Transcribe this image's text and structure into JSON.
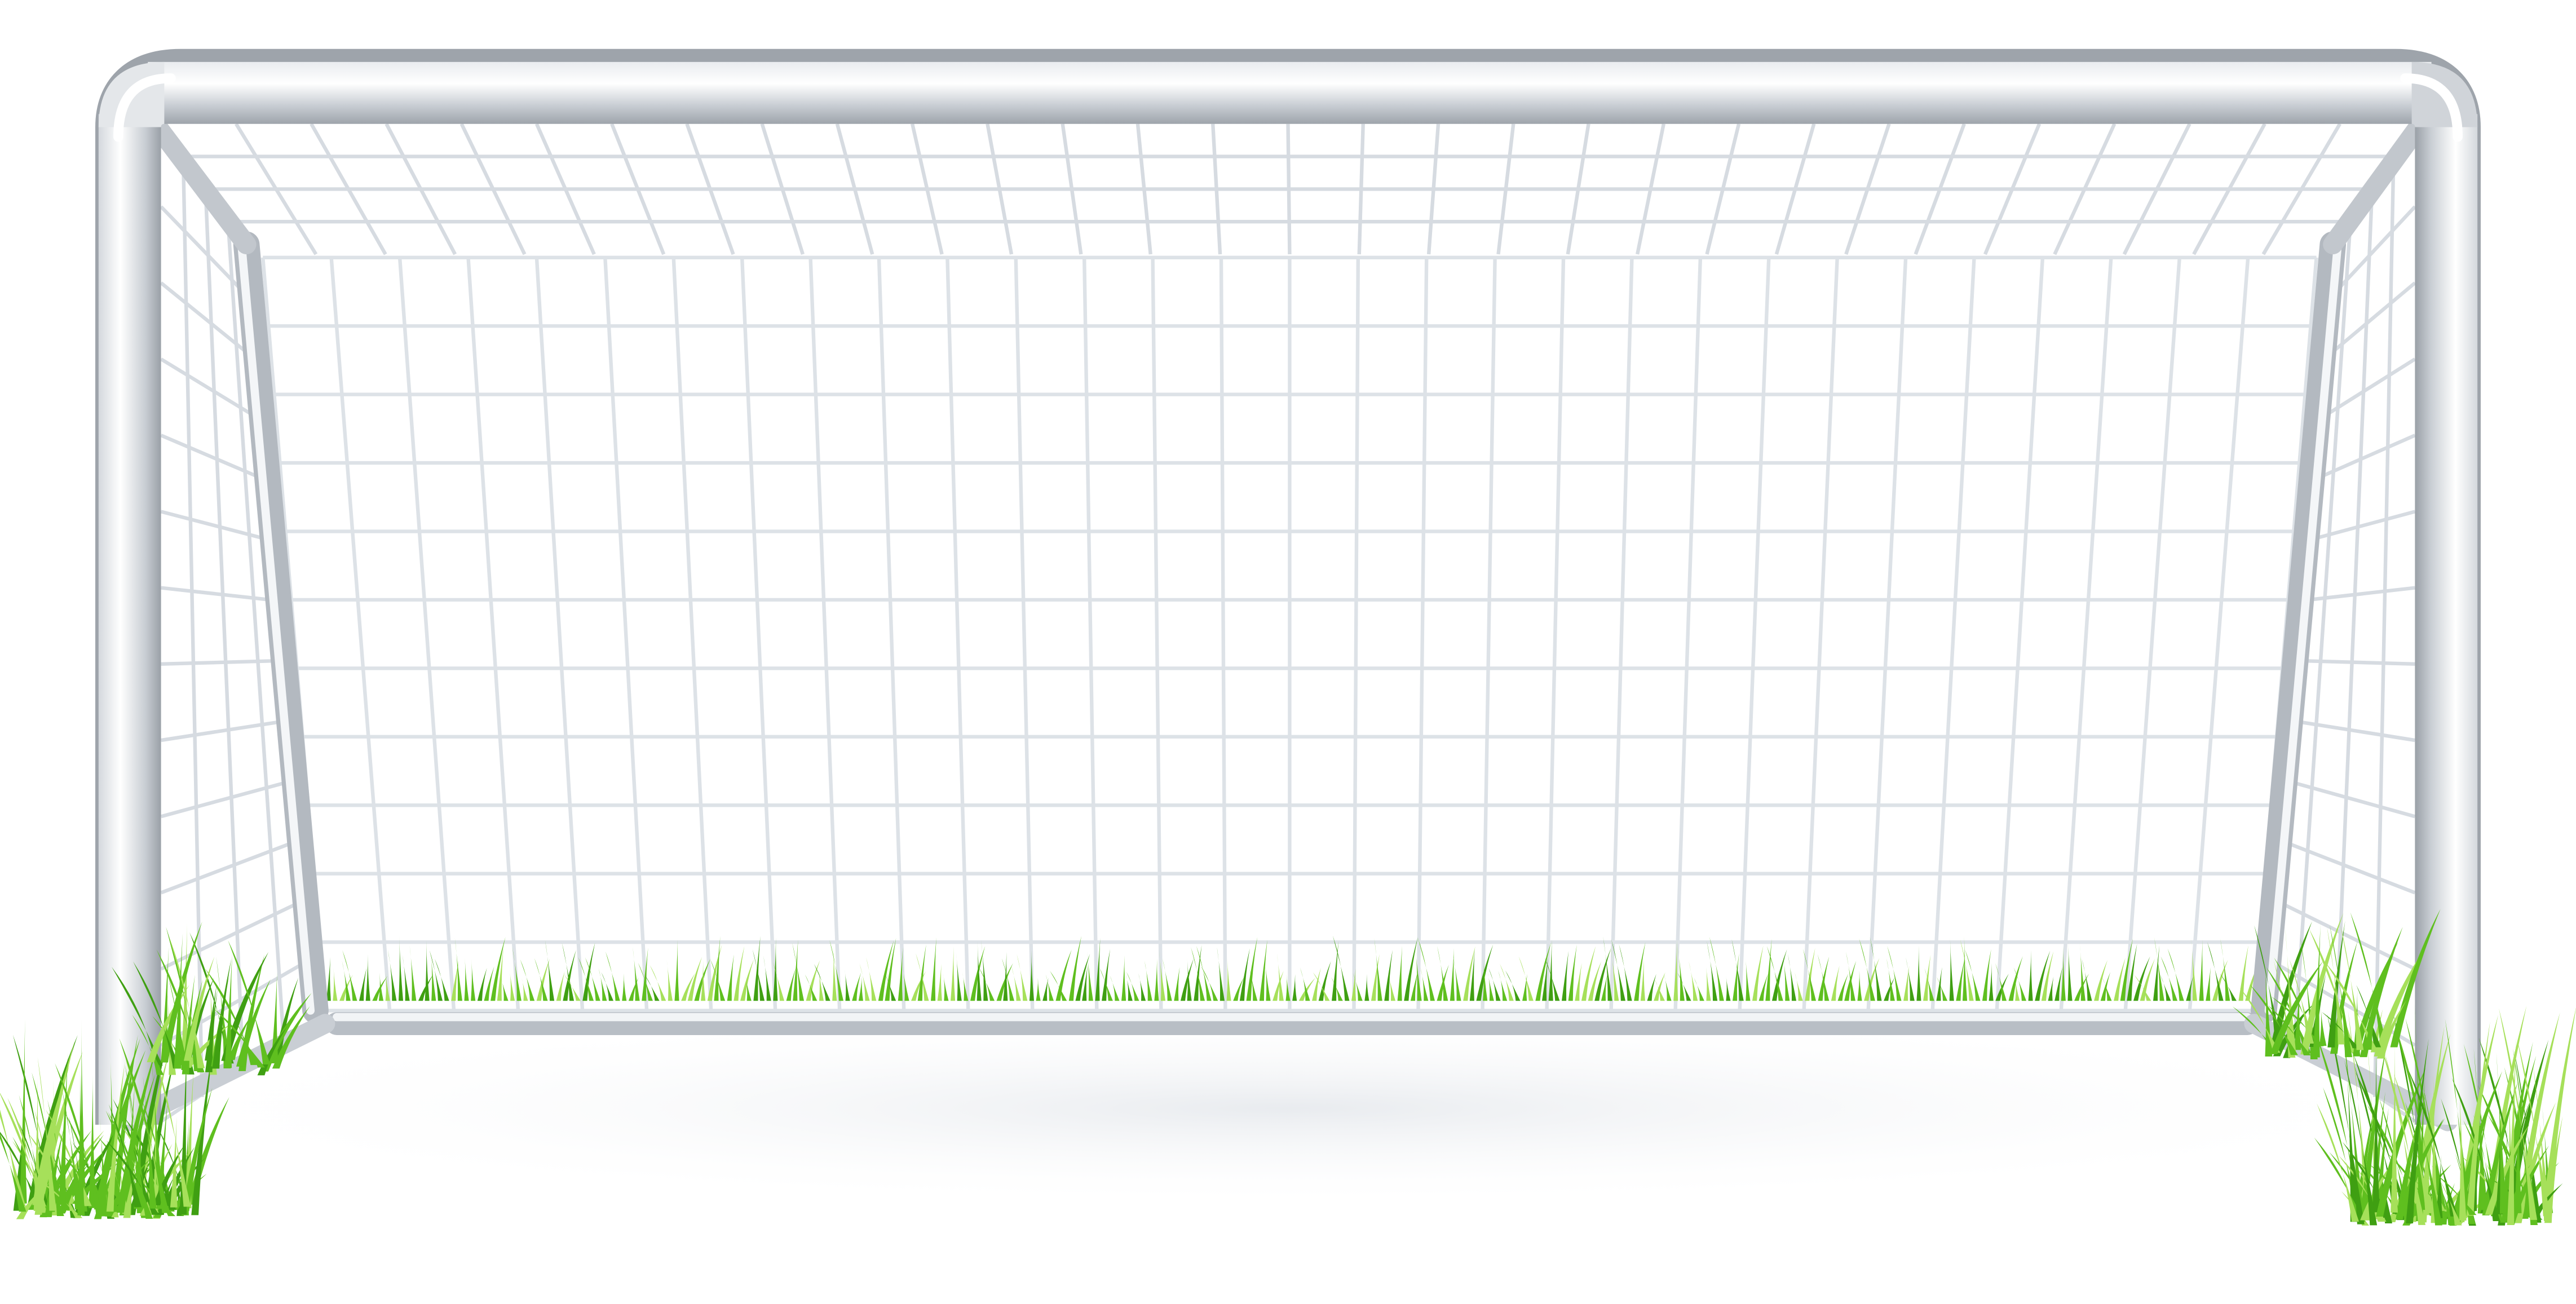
{
  "scene": {
    "subject": "soccer-goal",
    "colors": {
      "background": "#ffffff",
      "frame_light": "#f7f8fa",
      "frame_mid": "#cfd3d8",
      "frame_dark": "#9da3aa",
      "net_line": "#d8dde3",
      "net_line_back": "#e2e6ea",
      "grass_dark": "#3f9f12",
      "grass_mid": "#5fbf1f",
      "grass_light": "#a6e05a",
      "ground_shadow": "#eceff2"
    },
    "elements": {
      "frame": "goal-frame",
      "net": "goal-net",
      "grass": "grass-tufts"
    }
  }
}
